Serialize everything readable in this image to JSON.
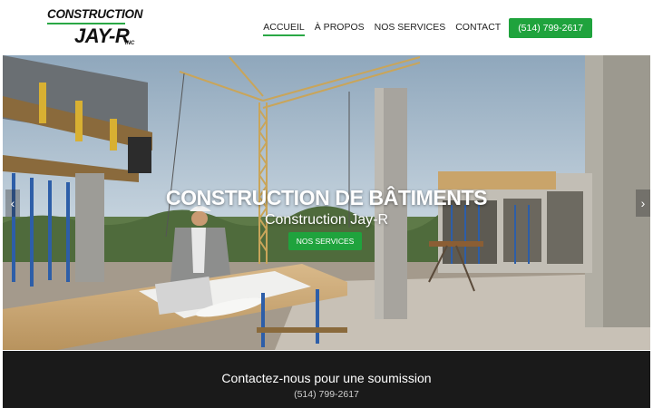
{
  "logo": {
    "line1": "CONSTRUCTION",
    "line2": "JAY-R",
    "suffix": "INC"
  },
  "nav": {
    "items": [
      {
        "label": "ACCUEIL",
        "active": true
      },
      {
        "label": "À PROPOS",
        "active": false
      },
      {
        "label": "NOS SERVICES",
        "active": false
      },
      {
        "label": "CONTACT",
        "active": false
      }
    ],
    "phone_button": "(514) 799-2617"
  },
  "hero": {
    "title": "CONSTRUCTION DE BÂTIMENTS",
    "subtitle": "Construction Jay-R",
    "button": "NOS SERVICES",
    "prev_icon": "chevron-left-icon",
    "next_icon": "chevron-right-icon"
  },
  "contact": {
    "title": "Contactez-nous pour une soumission",
    "phone": "(514) 799-2617"
  },
  "colors": {
    "accent": "#1fa33d",
    "band": "#1a1a1a"
  }
}
